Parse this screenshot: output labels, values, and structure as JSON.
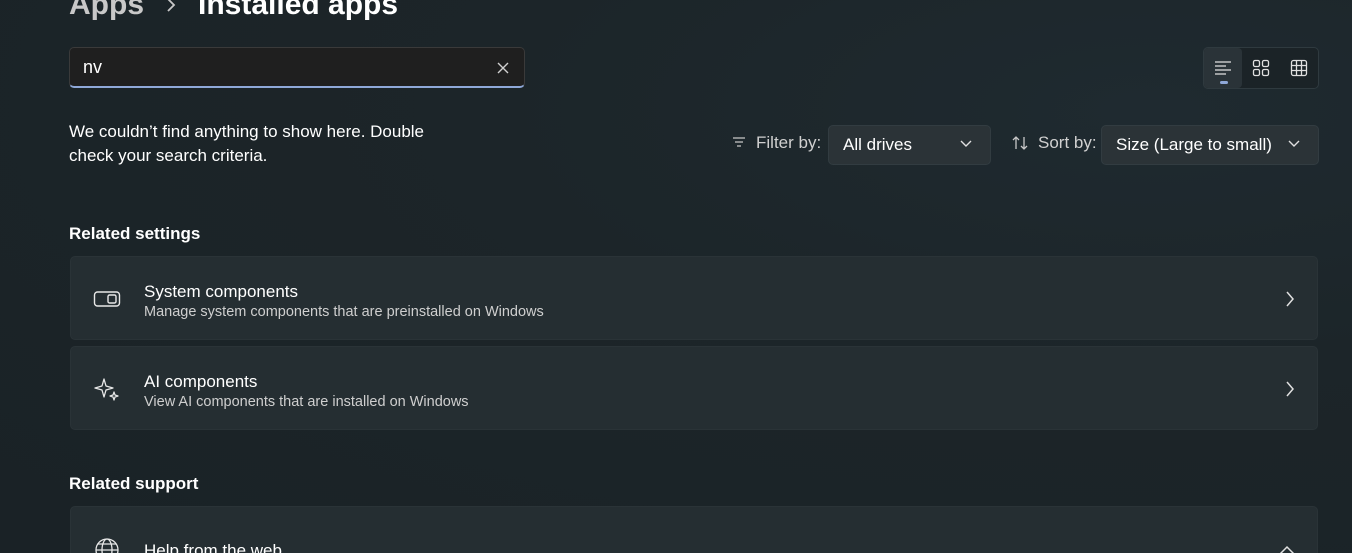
{
  "breadcrumb": {
    "parent": "Apps",
    "current": "Installed apps"
  },
  "search": {
    "value": "nv",
    "placeholder": ""
  },
  "view_modes": [
    "list",
    "tiles",
    "grid"
  ],
  "active_view": "list",
  "empty_message": "We couldn’t find anything to show here. Double check your search criteria.",
  "filter": {
    "label": "Filter by:",
    "value": "All drives"
  },
  "sort": {
    "label": "Sort by:",
    "value": "Size (Large to small)"
  },
  "related_settings": {
    "title": "Related settings",
    "items": [
      {
        "title": "System components",
        "description": "Manage system components that are preinstalled on Windows",
        "icon": "system-components-icon"
      },
      {
        "title": "AI components",
        "description": "View AI components that are installed on Windows",
        "icon": "sparkle-icon"
      }
    ]
  },
  "related_support": {
    "title": "Related support",
    "items": [
      {
        "title": "Help from the web",
        "icon": "globe-icon",
        "expanded": true
      }
    ]
  },
  "colors": {
    "accent": "#8fa8d8",
    "card_bg": "#252e32",
    "page_bg": "#1c2529"
  }
}
